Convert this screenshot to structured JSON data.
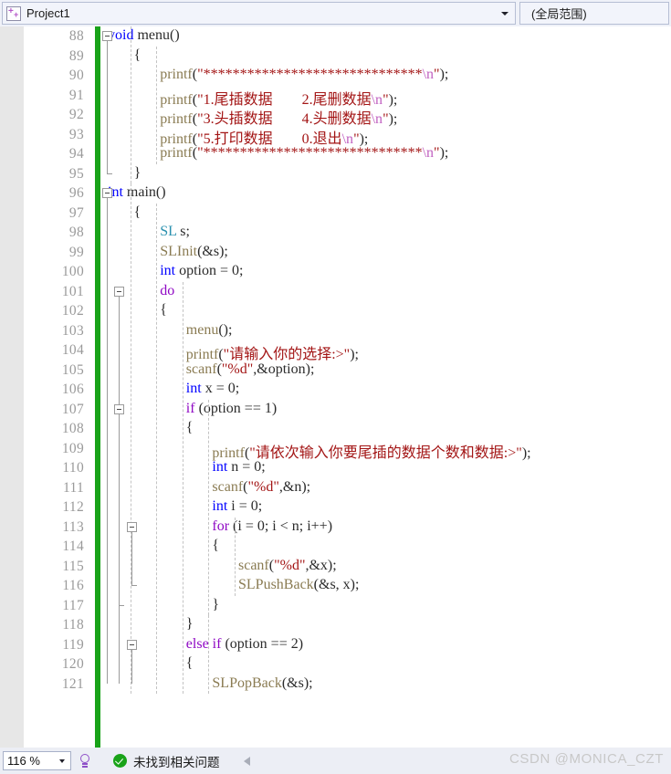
{
  "navbar": {
    "project_icon": "cpp-project-icon",
    "project_name": "Project1",
    "scope_label": "(全局范围)",
    "dropdown_icon": "chevron-down-icon"
  },
  "editor": {
    "first_line": 88,
    "lines": [
      {
        "n": 88,
        "tokens": [
          {
            "t": "kw",
            "s": "void"
          },
          {
            "t": "pl",
            "s": " menu()"
          }
        ]
      },
      {
        "n": 89,
        "tokens": [
          {
            "t": "pl",
            "s": "{"
          }
        ]
      },
      {
        "n": 90,
        "tokens": [
          {
            "t": "fn",
            "s": "printf"
          },
          {
            "t": "pl",
            "s": "("
          },
          {
            "t": "str",
            "s": "\"******************************"
          },
          {
            "t": "esc",
            "s": "\\n"
          },
          {
            "t": "str",
            "s": "\""
          },
          {
            "t": "pl",
            "s": ");"
          }
        ]
      },
      {
        "n": 91,
        "tokens": [
          {
            "t": "fn",
            "s": "printf"
          },
          {
            "t": "pl",
            "s": "("
          },
          {
            "t": "str",
            "s": "\"1.尾插数据        2.尾删数据"
          },
          {
            "t": "esc",
            "s": "\\n"
          },
          {
            "t": "str",
            "s": "\""
          },
          {
            "t": "pl",
            "s": ");"
          }
        ]
      },
      {
        "n": 92,
        "tokens": [
          {
            "t": "fn",
            "s": "printf"
          },
          {
            "t": "pl",
            "s": "("
          },
          {
            "t": "str",
            "s": "\"3.头插数据        4.头删数据"
          },
          {
            "t": "esc",
            "s": "\\n"
          },
          {
            "t": "str",
            "s": "\""
          },
          {
            "t": "pl",
            "s": ");"
          }
        ]
      },
      {
        "n": 93,
        "tokens": [
          {
            "t": "fn",
            "s": "printf"
          },
          {
            "t": "pl",
            "s": "("
          },
          {
            "t": "str",
            "s": "\"5.打印数据        0.退出"
          },
          {
            "t": "esc",
            "s": "\\n"
          },
          {
            "t": "str",
            "s": "\""
          },
          {
            "t": "pl",
            "s": ");"
          }
        ]
      },
      {
        "n": 94,
        "tokens": [
          {
            "t": "fn",
            "s": "printf"
          },
          {
            "t": "pl",
            "s": "("
          },
          {
            "t": "str",
            "s": "\"******************************"
          },
          {
            "t": "esc",
            "s": "\\n"
          },
          {
            "t": "str",
            "s": "\""
          },
          {
            "t": "pl",
            "s": ");"
          }
        ]
      },
      {
        "n": 95,
        "tokens": [
          {
            "t": "pl",
            "s": "}"
          }
        ]
      },
      {
        "n": 96,
        "tokens": [
          {
            "t": "kw",
            "s": "int"
          },
          {
            "t": "pl",
            "s": " main()"
          }
        ]
      },
      {
        "n": 97,
        "tokens": [
          {
            "t": "pl",
            "s": "{"
          }
        ]
      },
      {
        "n": 98,
        "tokens": [
          {
            "t": "type",
            "s": "SL"
          },
          {
            "t": "pl",
            "s": " s;"
          }
        ]
      },
      {
        "n": 99,
        "tokens": [
          {
            "t": "fn",
            "s": "SLInit"
          },
          {
            "t": "pl",
            "s": "(&s);"
          }
        ]
      },
      {
        "n": 100,
        "tokens": [
          {
            "t": "kw",
            "s": "int"
          },
          {
            "t": "pl",
            "s": " option = 0;"
          }
        ]
      },
      {
        "n": 101,
        "tokens": [
          {
            "t": "kwc",
            "s": "do"
          }
        ]
      },
      {
        "n": 102,
        "tokens": [
          {
            "t": "pl",
            "s": "{"
          }
        ]
      },
      {
        "n": 103,
        "tokens": [
          {
            "t": "fn",
            "s": "menu"
          },
          {
            "t": "pl",
            "s": "();"
          }
        ]
      },
      {
        "n": 104,
        "tokens": [
          {
            "t": "fn",
            "s": "printf"
          },
          {
            "t": "pl",
            "s": "("
          },
          {
            "t": "str",
            "s": "\"请输入你的选择:>\""
          },
          {
            "t": "pl",
            "s": ");"
          }
        ]
      },
      {
        "n": 105,
        "tokens": [
          {
            "t": "fn",
            "s": "scanf"
          },
          {
            "t": "pl",
            "s": "("
          },
          {
            "t": "str",
            "s": "\"%d\""
          },
          {
            "t": "pl",
            "s": ",&option);"
          }
        ]
      },
      {
        "n": 106,
        "tokens": [
          {
            "t": "kw",
            "s": "int"
          },
          {
            "t": "pl",
            "s": " x = 0;"
          }
        ]
      },
      {
        "n": 107,
        "tokens": [
          {
            "t": "kwc",
            "s": "if"
          },
          {
            "t": "pl",
            "s": " (option == 1)"
          }
        ]
      },
      {
        "n": 108,
        "tokens": [
          {
            "t": "pl",
            "s": "{"
          }
        ]
      },
      {
        "n": 109,
        "tokens": [
          {
            "t": "fn",
            "s": "printf"
          },
          {
            "t": "pl",
            "s": "("
          },
          {
            "t": "str",
            "s": "\"请依次输入你要尾插的数据个数和数据:>\""
          },
          {
            "t": "pl",
            "s": ");"
          }
        ]
      },
      {
        "n": 110,
        "tokens": [
          {
            "t": "kw",
            "s": "int"
          },
          {
            "t": "pl",
            "s": " n = 0;"
          }
        ]
      },
      {
        "n": 111,
        "tokens": [
          {
            "t": "fn",
            "s": "scanf"
          },
          {
            "t": "pl",
            "s": "("
          },
          {
            "t": "str",
            "s": "\"%d\""
          },
          {
            "t": "pl",
            "s": ",&n);"
          }
        ]
      },
      {
        "n": 112,
        "tokens": [
          {
            "t": "kw",
            "s": "int"
          },
          {
            "t": "pl",
            "s": " i = 0;"
          }
        ]
      },
      {
        "n": 113,
        "tokens": [
          {
            "t": "kwc",
            "s": "for"
          },
          {
            "t": "pl",
            "s": " (i = 0; i < n; i++)"
          }
        ]
      },
      {
        "n": 114,
        "tokens": [
          {
            "t": "pl",
            "s": "{"
          }
        ]
      },
      {
        "n": 115,
        "tokens": [
          {
            "t": "fn",
            "s": "scanf"
          },
          {
            "t": "pl",
            "s": "("
          },
          {
            "t": "str",
            "s": "\"%d\""
          },
          {
            "t": "pl",
            "s": ",&x);"
          }
        ]
      },
      {
        "n": 116,
        "tokens": [
          {
            "t": "fn",
            "s": "SLPushBack"
          },
          {
            "t": "pl",
            "s": "(&s, x);"
          }
        ]
      },
      {
        "n": 117,
        "tokens": [
          {
            "t": "pl",
            "s": "}"
          }
        ]
      },
      {
        "n": 118,
        "tokens": [
          {
            "t": "pl",
            "s": "}"
          }
        ]
      },
      {
        "n": 119,
        "tokens": [
          {
            "t": "kwc",
            "s": "else if"
          },
          {
            "t": "pl",
            "s": " (option == 2)"
          }
        ]
      },
      {
        "n": 120,
        "tokens": [
          {
            "t": "pl",
            "s": "{"
          }
        ]
      },
      {
        "n": 121,
        "tokens": [
          {
            "t": "fn",
            "s": "SLPopBack"
          },
          {
            "t": "pl",
            "s": "(&s);"
          }
        ]
      }
    ],
    "indents": [
      0,
      1,
      2,
      2,
      2,
      2,
      2,
      1,
      0,
      1,
      2,
      2,
      2,
      2,
      2,
      3,
      3,
      3,
      3,
      3,
      3,
      4,
      4,
      4,
      4,
      4,
      4,
      5,
      5,
      4,
      3,
      3,
      3,
      4
    ],
    "fold_lines": [
      88,
      96,
      101,
      107,
      113,
      119
    ],
    "change_bar_color": "#19a319"
  },
  "statusbar": {
    "zoom_level": "116 %",
    "zoom_dropdown_icon": "chevron-down-icon",
    "lightbulb_icon": "lightbulb-icon",
    "ok_icon": "check-circle-icon",
    "message": "未找到相关问题",
    "nav_caret_icon": "caret-left-icon"
  },
  "watermark": "CSDN @MONICA_CZT",
  "colors": {
    "keyword": "#0000ff",
    "control_keyword": "#8f08c4",
    "type": "#2b91af",
    "function": "#8a7b52",
    "string": "#a31515",
    "escape": "#c060c0",
    "linenumber": "#9a9a9a",
    "changebar": "#19a319",
    "chrome": "#eff1f8"
  }
}
